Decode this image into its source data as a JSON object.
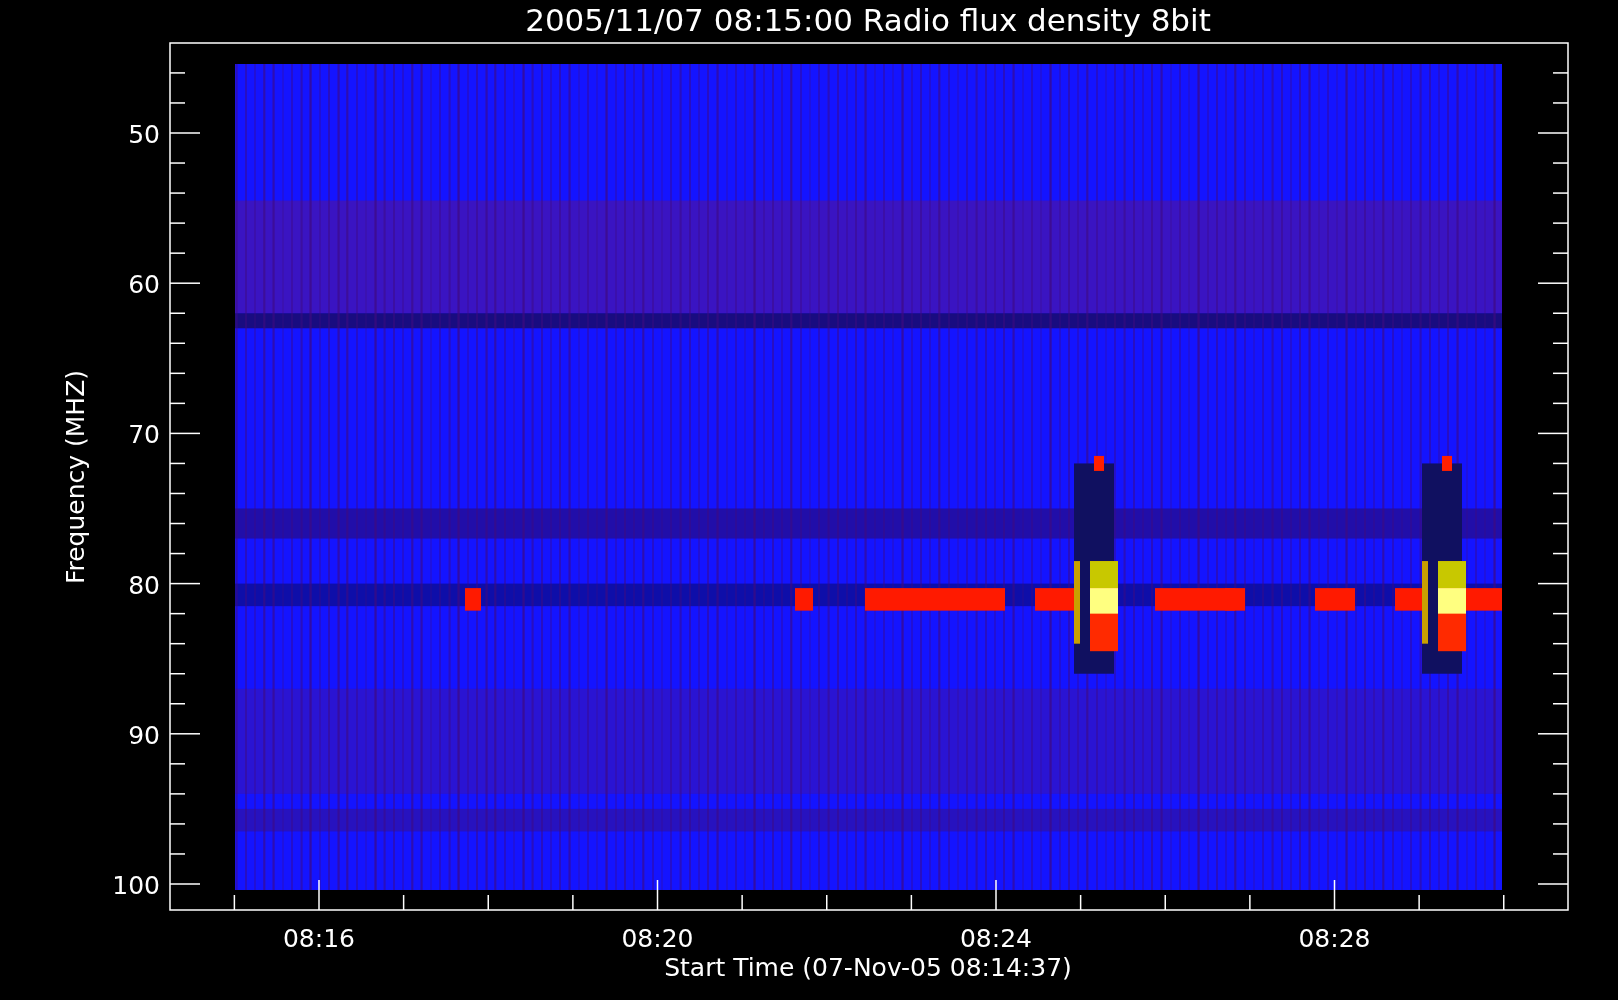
{
  "title": "2005/11/07 08:15:00 Radio flux density 8bit",
  "y_axis": {
    "label": "Frequency (MHZ)",
    "ticks": [
      "50",
      "60",
      "70",
      "80",
      "90",
      "100"
    ]
  },
  "x_axis": {
    "label": "Start Time (07-Nov-05 08:14:37)",
    "ticks": [
      "08:16",
      "08:20",
      "08:24",
      "08:28"
    ]
  }
}
